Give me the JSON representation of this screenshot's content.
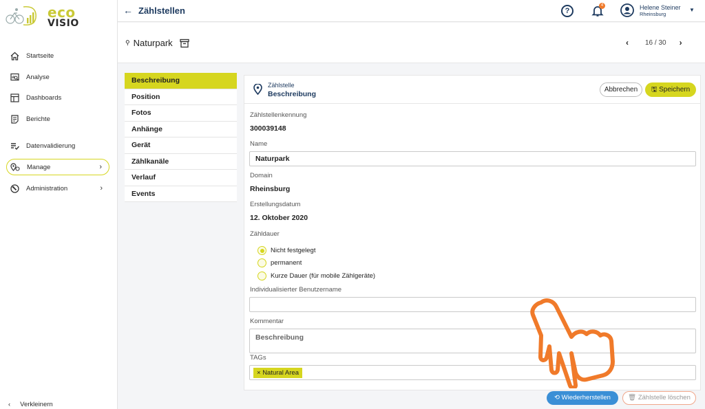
{
  "brand": {
    "line1": "eco",
    "line2": "VISIO"
  },
  "sidebar": {
    "items": [
      {
        "label": "Startseite",
        "icon": "home-icon"
      },
      {
        "label": "Analyse",
        "icon": "analysis-icon"
      },
      {
        "label": "Dashboards",
        "icon": "dashboard-icon"
      },
      {
        "label": "Berichte",
        "icon": "report-icon"
      },
      {
        "label": "Datenvalidierung",
        "icon": "validation-icon"
      },
      {
        "label": "Manage",
        "icon": "manage-icon",
        "active": true
      },
      {
        "label": "Administration",
        "icon": "administration-icon"
      }
    ],
    "collapse_label": "Verkleinern"
  },
  "topbar": {
    "back_title": "Zählstellen",
    "notification_count": "4",
    "user_name": "Helene Steiner",
    "user_domain": "Rheinsburg"
  },
  "subheader": {
    "location_name": "Naturpark",
    "pager": "16 / 30"
  },
  "tabs": [
    "Beschreibung",
    "Position",
    "Fotos",
    "Anhänge",
    "Gerät",
    "Zählkanäle",
    "Verlauf",
    "Events"
  ],
  "panel": {
    "kicker": "Zählstelle",
    "title": "Beschreibung",
    "cancel_label": "Abbrechen",
    "save_label": "Speichern",
    "fields": {
      "id_label": "Zählstellenkennung",
      "id_value": "300039148",
      "name_label": "Name",
      "name_value": "Naturpark",
      "domain_label": "Domain",
      "domain_value": "Rheinsburg",
      "created_label": "Erstellungsdatum",
      "created_value": "12. Oktober 2020",
      "duration_label": "Zähldauer",
      "duration_options": [
        "Nicht festgelegt",
        "permanent",
        "Kurze Dauer (für mobile Zählgeräte)"
      ],
      "duration_selected": "Nicht festgelegt",
      "username_label": "Individualisierter Benutzername",
      "username_value": "",
      "comment_label": "Kommentar",
      "comment_value": "Beschreibung",
      "tags_label": "TAGs",
      "tags": [
        "Natural Area"
      ]
    }
  },
  "footer": {
    "restore_label": "Wiederherstellen",
    "delete_label": "Zählstelle löschen"
  },
  "colors": {
    "accent": "#d6d61f",
    "navy": "#1d3a5f",
    "restore": "#3a8fd6",
    "badge": "#f07a2a",
    "hand": "#f07a2a"
  }
}
